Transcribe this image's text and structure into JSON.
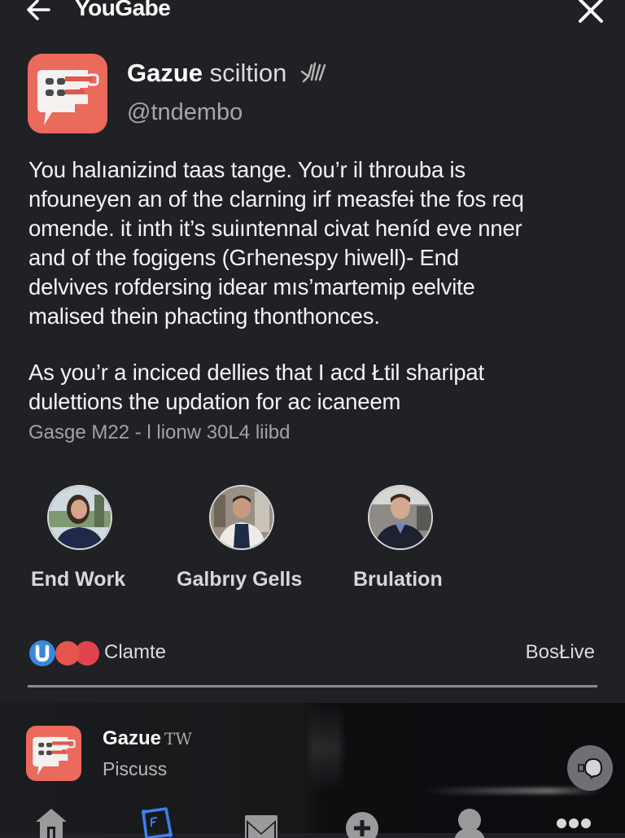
{
  "topbar": {
    "title": "YouGabe",
    "back_icon": "arrow-left-icon",
    "close_icon": "close-icon"
  },
  "post": {
    "author_name": "Gazue",
    "author_rest": "sciltion",
    "handle": "@tndembo",
    "logo_icon": "chat-bubble-logo-icon",
    "verified_icon": "badge-icon",
    "body_lines": [
      "You halıanizind taas tange.  You’r il throuba is",
      "nfouneyen an of the clarning irf measfeɨ the fos req",
      "omende. it inth it’s suiıntennal civat heníd eve nner",
      "and of the fogigens (Gгhenespy hiwell)- End",
      "delvives rofdersing idear mıs’martemip eelvite",
      "malised thein phacting thonthonces."
    ],
    "body2_lines": [
      "As you’r a inciced dellies that I aсd Łtil sharipat",
      "dulettions the updation for ac icaneem"
    ],
    "meta": "Gasge M22 - l lionw 30L4 liibd"
  },
  "people": [
    {
      "name": "End Work"
    },
    {
      "name": "Galbrıy  Gells"
    },
    {
      "name": "Brulation"
    }
  ],
  "reactions": {
    "label": "Clamte",
    "right_label": "BosŁive",
    "colors": {
      "blue": "#3b86e0",
      "red1": "#e5554c",
      "red2": "#e3424f"
    }
  },
  "mini_post": {
    "title": "Gazue",
    "badge": "TW",
    "subtitle": "Piscuss"
  },
  "nav": {
    "items": [
      {
        "icon": "home-icon"
      },
      {
        "icon": "compose-icon",
        "active": true
      },
      {
        "icon": "mail-icon"
      },
      {
        "icon": "add-icon"
      },
      {
        "icon": "profile-icon"
      },
      {
        "icon": "more-icon"
      }
    ],
    "active_color": "#3a82e8",
    "inactive_color": "#9a9a9c"
  },
  "colors": {
    "background": "#1f2124",
    "brand": "#ea6a5c"
  }
}
